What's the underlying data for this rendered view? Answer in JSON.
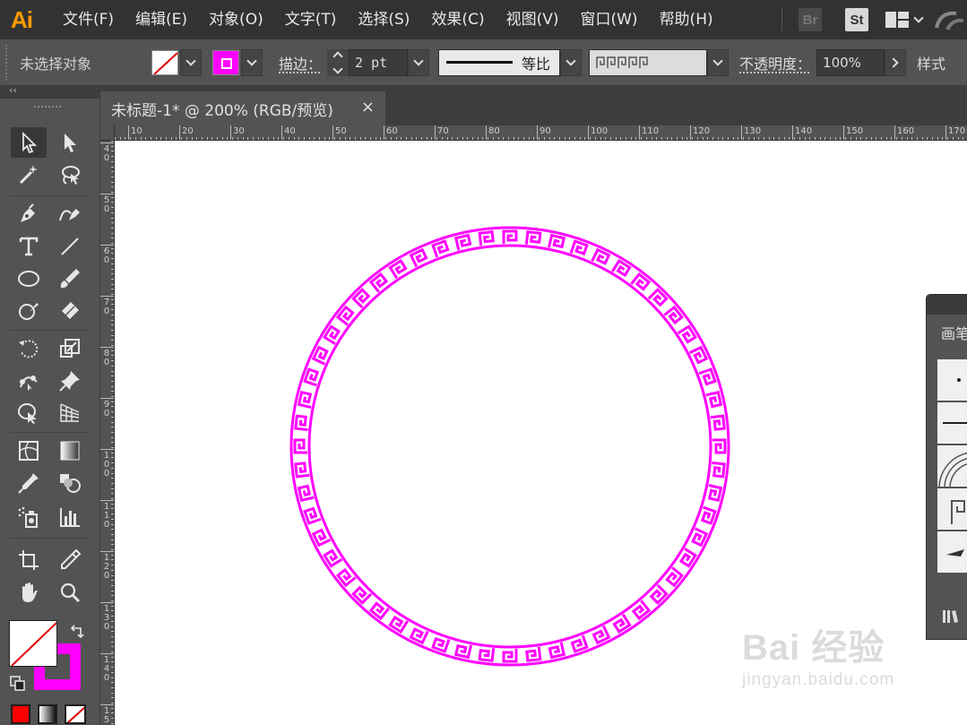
{
  "app": {
    "logo": "Ai"
  },
  "menu": [
    "文件(F)",
    "编辑(E)",
    "对象(O)",
    "文字(T)",
    "选择(S)",
    "效果(C)",
    "视图(V)",
    "窗口(W)",
    "帮助(H)"
  ],
  "menubar_right": {
    "bridge": "Br",
    "stock": "St"
  },
  "control": {
    "selection_status": "未选择对象",
    "stroke_label": "描边：",
    "stroke_weight": "2 pt",
    "profile_label": "等比",
    "opacity_label": "不透明度：",
    "opacity_value": "100%",
    "style_label": "样式"
  },
  "panel_collapse": "‹‹",
  "document": {
    "tab_title": "未标题-1* @ 200% (RGB/预览)",
    "close": "×"
  },
  "ruler_h": [
    "10",
    "20",
    "30",
    "40",
    "50",
    "60",
    "70",
    "80",
    "90",
    "100",
    "110",
    "120",
    "130",
    "140",
    "150",
    "160",
    "170"
  ],
  "ruler_v": [
    "4 0",
    "5 0",
    "6 0",
    "7 0",
    "8 0",
    "9 0",
    "1 0 0",
    "1 1 0",
    "1 2 0",
    "1 3 0",
    "1 4 0",
    "1 5 0"
  ],
  "brushes_panel": {
    "title": "画笔"
  },
  "watermark": {
    "logo": "Bai 经验",
    "url": "jingyan.baidu.com"
  },
  "colors": {
    "accent": "#ff00ff",
    "logo": "#ff9a00",
    "fill_none_slash": "#e00000"
  }
}
